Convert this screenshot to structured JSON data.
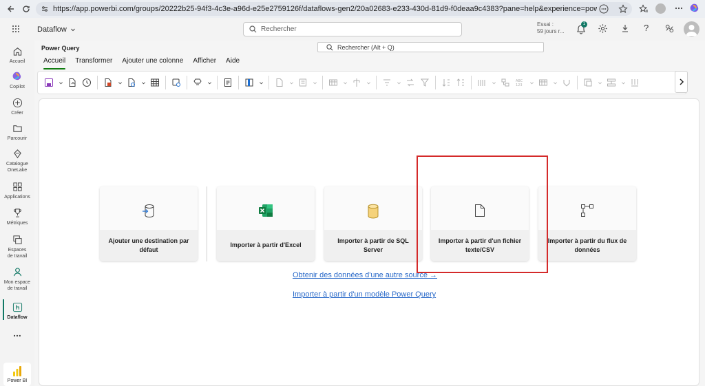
{
  "browser": {
    "url": "https://app.powerbi.com/groups/20222b25-94f3-4c3e-a96d-e25e2759126f/dataflows-gen2/20a02683-e233-430d-81d9-f0deaa9c4383?pane=help&experience=power-bi"
  },
  "header": {
    "app_name": "Dataflow",
    "search_placeholder": "Rechercher",
    "trial_line1": "Essai :",
    "trial_line2": "59 jours r...",
    "notification_count": "1"
  },
  "leftnav": {
    "items": [
      {
        "label": "Accueil",
        "icon": "home-icon"
      },
      {
        "label": "Copilot",
        "icon": "copilot-icon"
      },
      {
        "label": "Créer",
        "icon": "plus-icon"
      },
      {
        "label": "Parcourir",
        "icon": "folder-icon"
      },
      {
        "label": "Catalogue OneLake",
        "icon": "onelake-icon"
      },
      {
        "label": "Applications",
        "icon": "apps-icon"
      },
      {
        "label": "Métriques",
        "icon": "trophy-icon"
      },
      {
        "label": "Espaces de travail",
        "icon": "workspaces-icon"
      },
      {
        "label": "Mon espace de travail",
        "icon": "person-icon"
      },
      {
        "label": "Dataflow",
        "icon": "dataflow-icon"
      }
    ],
    "more": "...",
    "powerbi": "Power BI"
  },
  "pq": {
    "title": "Power Query",
    "search_placeholder": "Rechercher (Alt + Q)",
    "tabs": [
      "Accueil",
      "Transformer",
      "Ajouter une colonne",
      "Afficher",
      "Aide"
    ],
    "active_tab": "Accueil"
  },
  "cards": [
    {
      "label": "Ajouter une destination par défaut",
      "icon": "destination-icon"
    },
    {
      "label": "Importer à partir d'Excel",
      "icon": "excel-icon"
    },
    {
      "label": "Importer à partir de SQL Server",
      "icon": "sql-server-icon"
    },
    {
      "label": "Importer à partir d'un fichier texte/CSV",
      "icon": "file-icon"
    },
    {
      "label": "Importer à partir du flux de données",
      "icon": "dataflow-flow-icon"
    }
  ],
  "links": {
    "other_source": "Obtenir des données d'une autre source →",
    "pq_template": "Importer à partir d'un modèle Power Query"
  },
  "colors": {
    "accent": "#117865",
    "highlight": "#d42a2a",
    "link": "#2a6ac9"
  }
}
